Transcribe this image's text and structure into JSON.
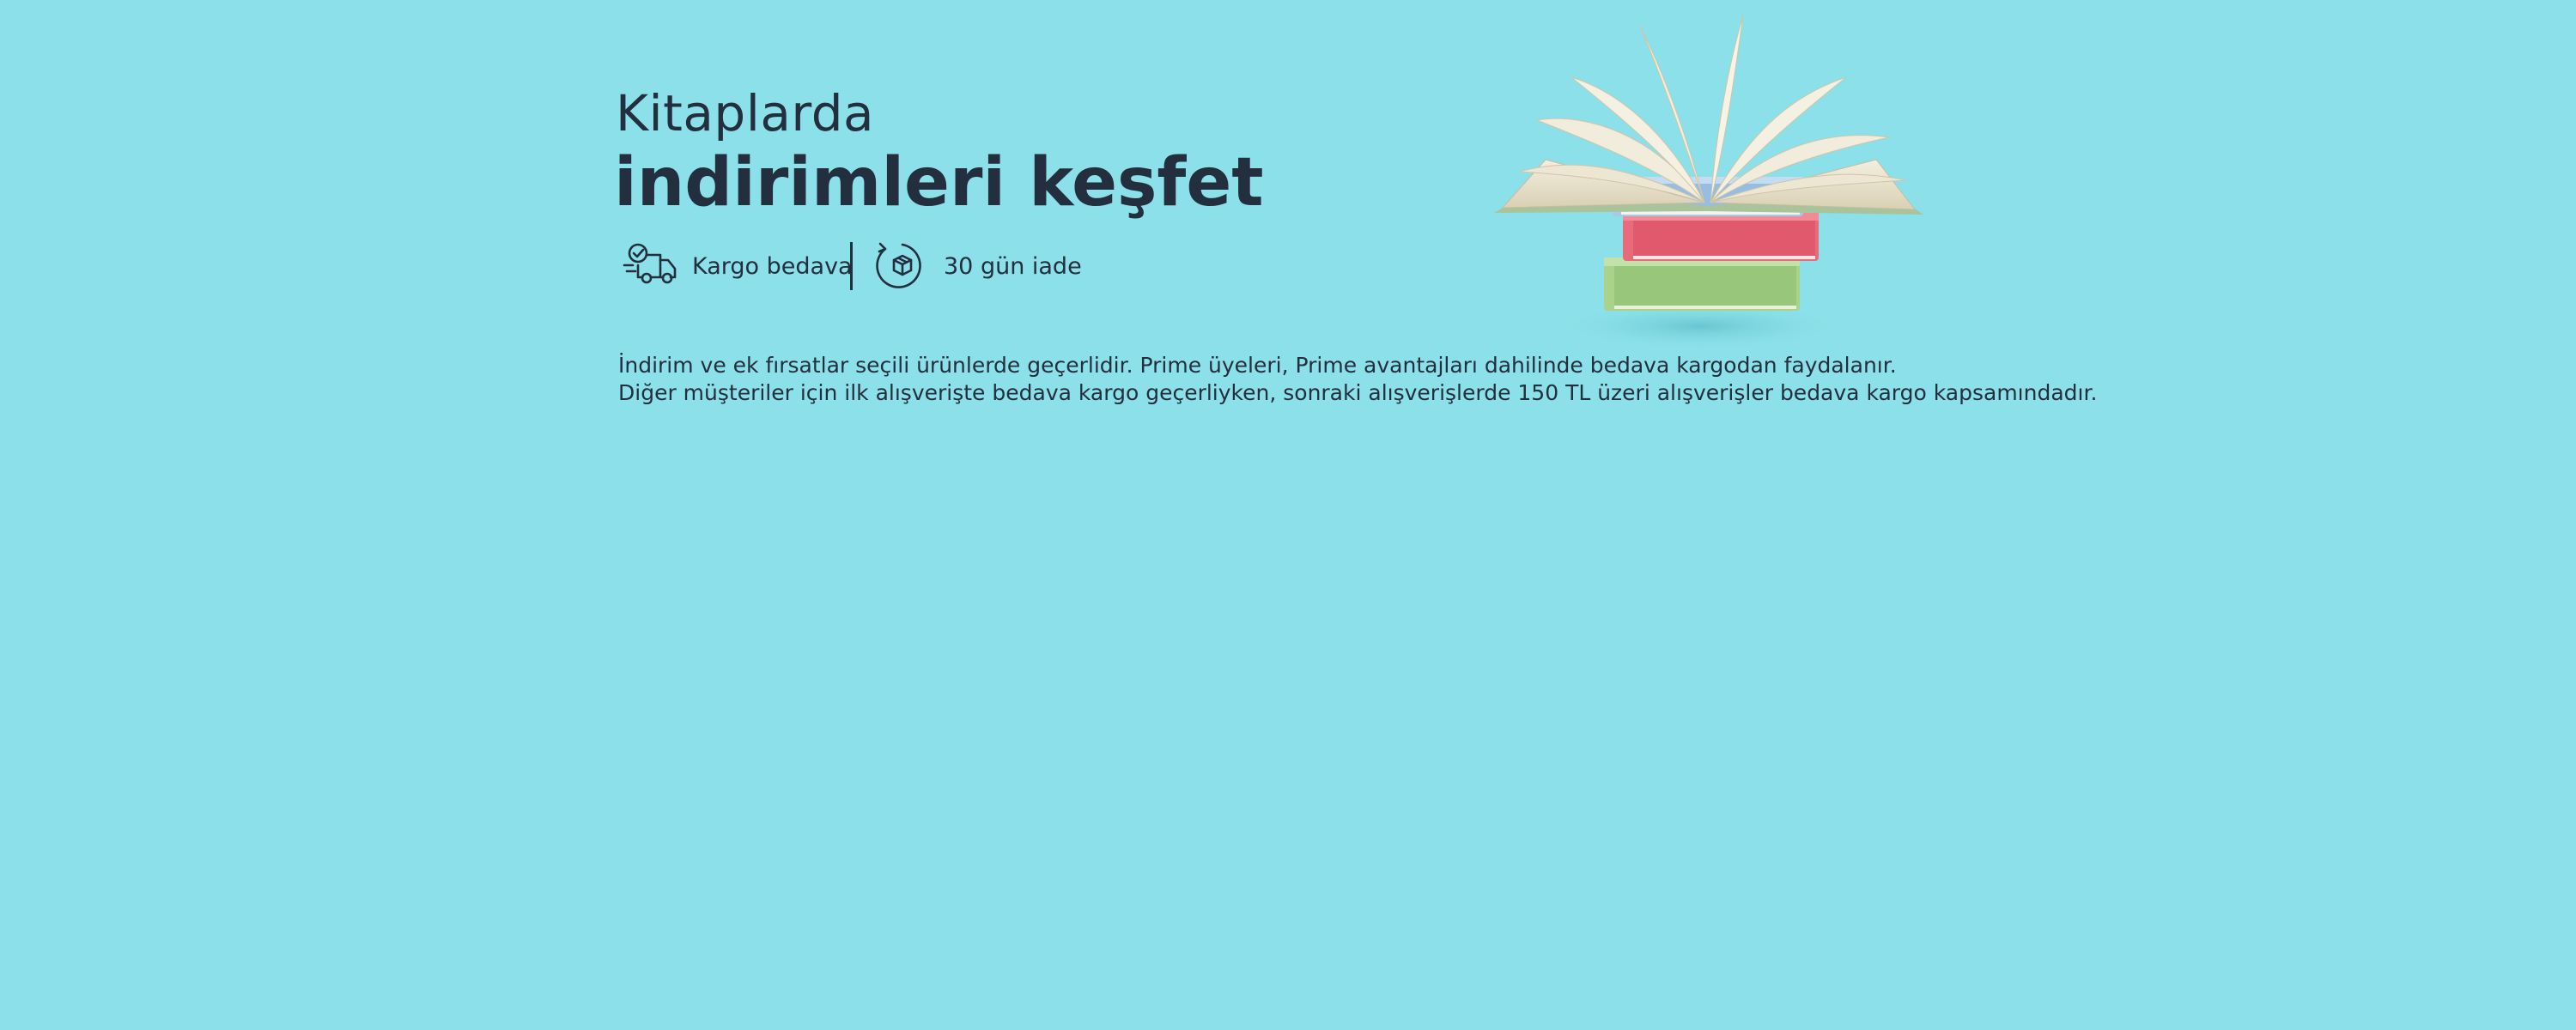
{
  "banner": {
    "background_color": "#8ce0e9",
    "text_color": "#232f3e",
    "headline_small": "Kitaplarda",
    "headline_big": "indirimleri keşfet",
    "features": [
      {
        "icon": "delivery-truck-icon",
        "label": "Kargo bedava"
      },
      {
        "icon": "return-box-icon",
        "label": "30 gün iade"
      }
    ],
    "disclaimer": {
      "line1": "İndirim ve ek fırsatlar seçili ürünlerde geçerlidir. Prime üyeleri, Prime avantajları dahilinde bedava kargodan faydalanır.",
      "line2": "Diğer müşteriler için ilk alışverişte bedava kargo geçerliyken, sonraki alışverişlerde 150 TL üzeri alışverişler bedava kargo kapsamındadır."
    },
    "illustration": "book-stack-illustration"
  }
}
